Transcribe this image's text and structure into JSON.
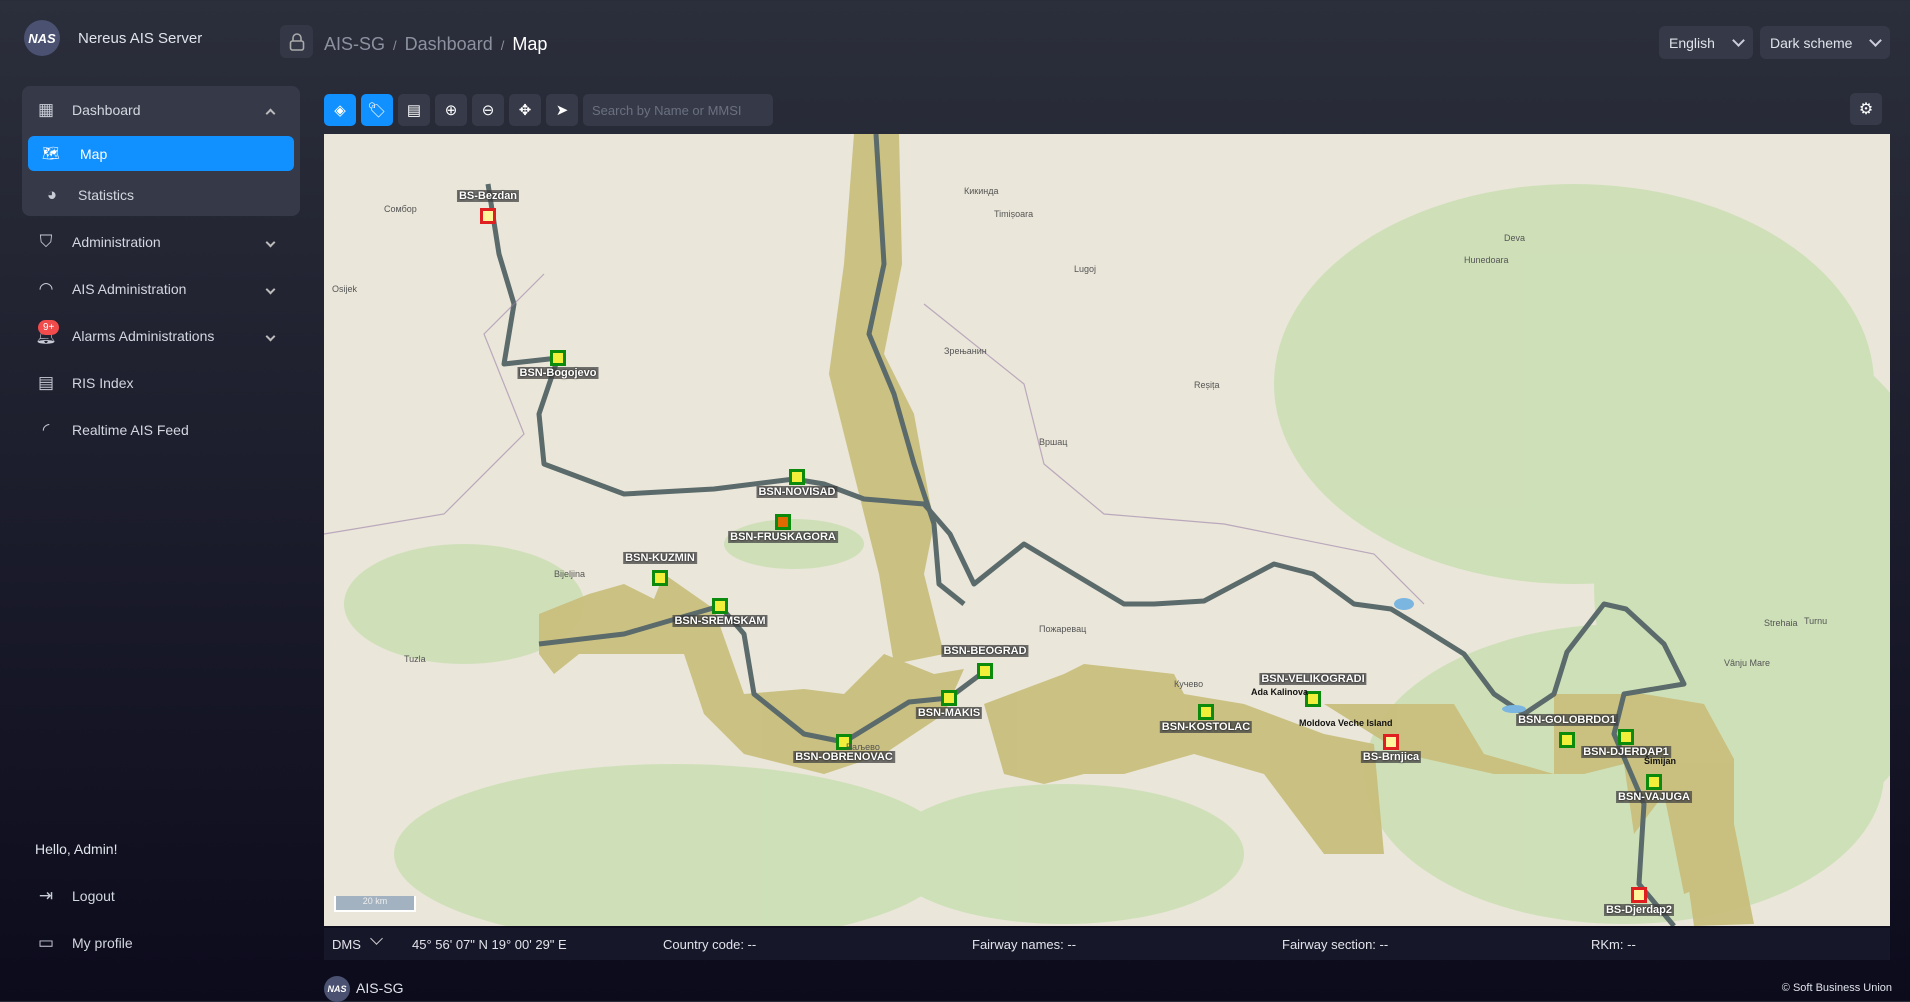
{
  "header": {
    "logo_text": "NAS",
    "app_title": "Nereus AIS Server",
    "breadcrumb": [
      "AIS-SG",
      "Dashboard",
      "Map"
    ],
    "language": "English",
    "scheme": "Dark scheme"
  },
  "sidebar": {
    "items": [
      {
        "label": "Dashboard",
        "icon": "solar-panel-icon",
        "expanded": true,
        "children": [
          {
            "label": "Map",
            "icon": "map-icon",
            "active": true
          },
          {
            "label": "Statistics",
            "icon": "pie-chart-icon"
          }
        ]
      },
      {
        "label": "Administration",
        "icon": "shield-icon"
      },
      {
        "label": "AIS Administration",
        "icon": "wifi-icon"
      },
      {
        "label": "Alarms Administrations",
        "icon": "bell-icon",
        "badge": "9+"
      },
      {
        "label": "RIS Index",
        "icon": "book-icon"
      },
      {
        "label": "Realtime AIS Feed",
        "icon": "rss-icon"
      }
    ],
    "greeting": "Hello, Admin!",
    "logout": "Logout",
    "profile": "My profile"
  },
  "toolbar": {
    "search_placeholder": "Search by Name or MMSI"
  },
  "map": {
    "stations": [
      {
        "name": "BS-Bezdan",
        "status": "red"
      },
      {
        "name": "BSN-Bogojevo",
        "status": "green"
      },
      {
        "name": "BSN-NOVISAD",
        "status": "green"
      },
      {
        "name": "BSN-FRUSKAGORA",
        "status": "orange"
      },
      {
        "name": "BSN-KUZMIN",
        "status": "green"
      },
      {
        "name": "BSN-SREMSKAM",
        "status": "green"
      },
      {
        "name": "BSN-BEOGRAD",
        "status": "green"
      },
      {
        "name": "BSN-MAKIS",
        "status": "green"
      },
      {
        "name": "BSN-OBRENOVAC",
        "status": "green"
      },
      {
        "name": "BSN-KOSTOLAC",
        "status": "green"
      },
      {
        "name": "BSN-VELIKOGRADI",
        "status": "green"
      },
      {
        "name": "BS-Brnjica",
        "status": "red"
      },
      {
        "name": "BSN-GOLOBRDO1",
        "status": "green"
      },
      {
        "name": "BSN-DJERDAP1",
        "status": "green"
      },
      {
        "name": "BSN-VAJUGA",
        "status": "green"
      },
      {
        "name": "BS-Djerdap2",
        "status": "red"
      }
    ],
    "status_colors": {
      "green": "#0b8a0b",
      "red": "#e02020",
      "orange": "#e06a00"
    },
    "islands": [
      "Ada Kalinova",
      "Moldova Veche Island",
      "Šimijan"
    ],
    "towns": [
      "Сомбор",
      "Osijek",
      "Кикинда",
      "Timișoara",
      "Lugoj",
      "Зрењанин",
      "Reșița",
      "Вршац",
      "Bijeljina",
      "Tuzla",
      "Ваљево",
      "Пожаревац",
      "Кучево",
      "Deva",
      "Hunedoara",
      "Vânju Mare",
      "Strehaia",
      "Turnu"
    ],
    "scale": "20 km"
  },
  "status": {
    "format": "DMS",
    "coords": "45° 56' 07\" N 19° 00' 29\" E",
    "country": "Country code: --",
    "fairway_names": "Fairway names: --",
    "fairway_section": "Fairway section: --",
    "rkm": "RKm: --"
  },
  "footer": {
    "app": "AIS-SG",
    "copyright": "© Soft Business Union"
  }
}
